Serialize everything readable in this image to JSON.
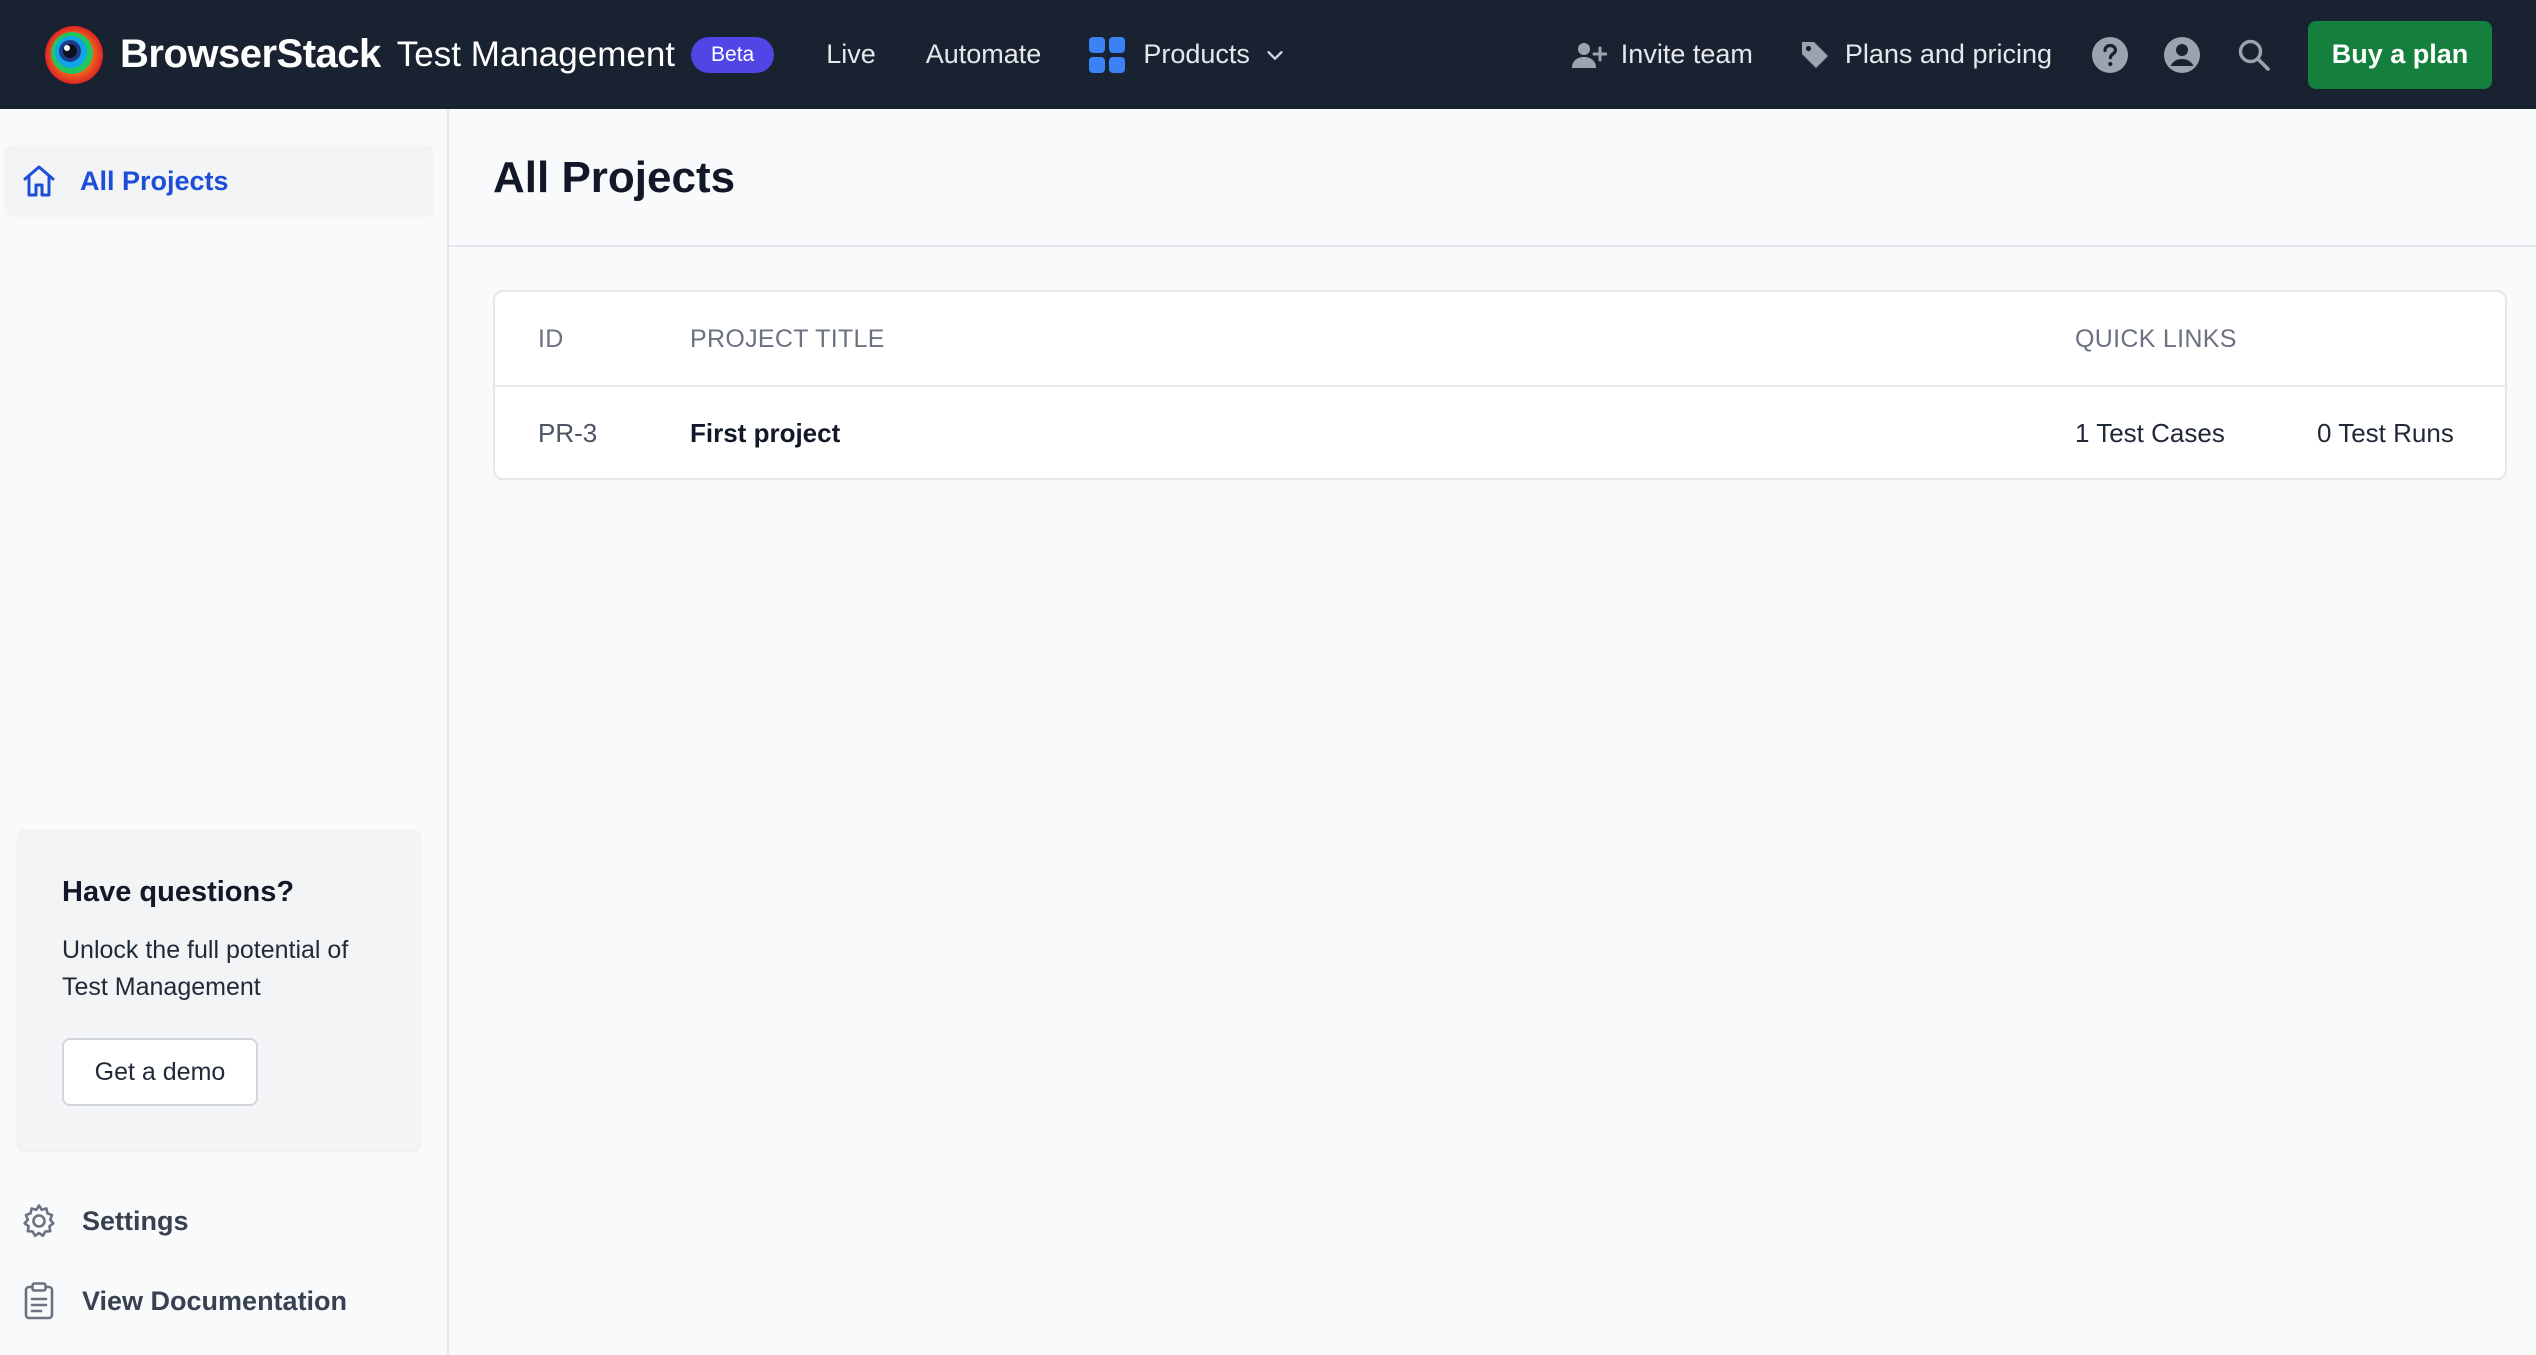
{
  "topbar": {
    "brand_name": "BrowserStack",
    "product_name": "Test Management",
    "beta_label": "Beta",
    "nav": [
      "Live",
      "Automate"
    ],
    "products_label": "Products",
    "invite_label": "Invite team",
    "plans_label": "Plans and pricing",
    "buy_label": "Buy a plan",
    "icons": {
      "logo": "browserstack-logo",
      "grid": "products-grid-icon",
      "chevron": "chevron-down-icon",
      "invite": "user-plus-icon",
      "plans": "tag-icon",
      "help": "help-circle-icon",
      "account": "account-circle-icon",
      "search": "search-icon"
    },
    "colors": {
      "bar": "#192230",
      "buy": "#15803d",
      "beta": "#4f46e5",
      "grid": "#3b82f6"
    }
  },
  "sidebar": {
    "active_item": "All Projects",
    "help_card": {
      "title": "Have questions?",
      "description": "Unlock the full potential of Test Management",
      "button": "Get a demo"
    },
    "settings_label": "Settings",
    "docs_label": "View Documentation",
    "colors": {
      "active_text": "#1d4ed8"
    }
  },
  "main": {
    "title": "All Projects",
    "table": {
      "headers": {
        "id": "ID",
        "title": "PROJECT TITLE",
        "links": "QUICK LINKS"
      },
      "rows": [
        {
          "id": "PR-3",
          "title": "First project",
          "cases": "1 Test Cases",
          "runs": "0 Test Runs"
        }
      ]
    }
  }
}
